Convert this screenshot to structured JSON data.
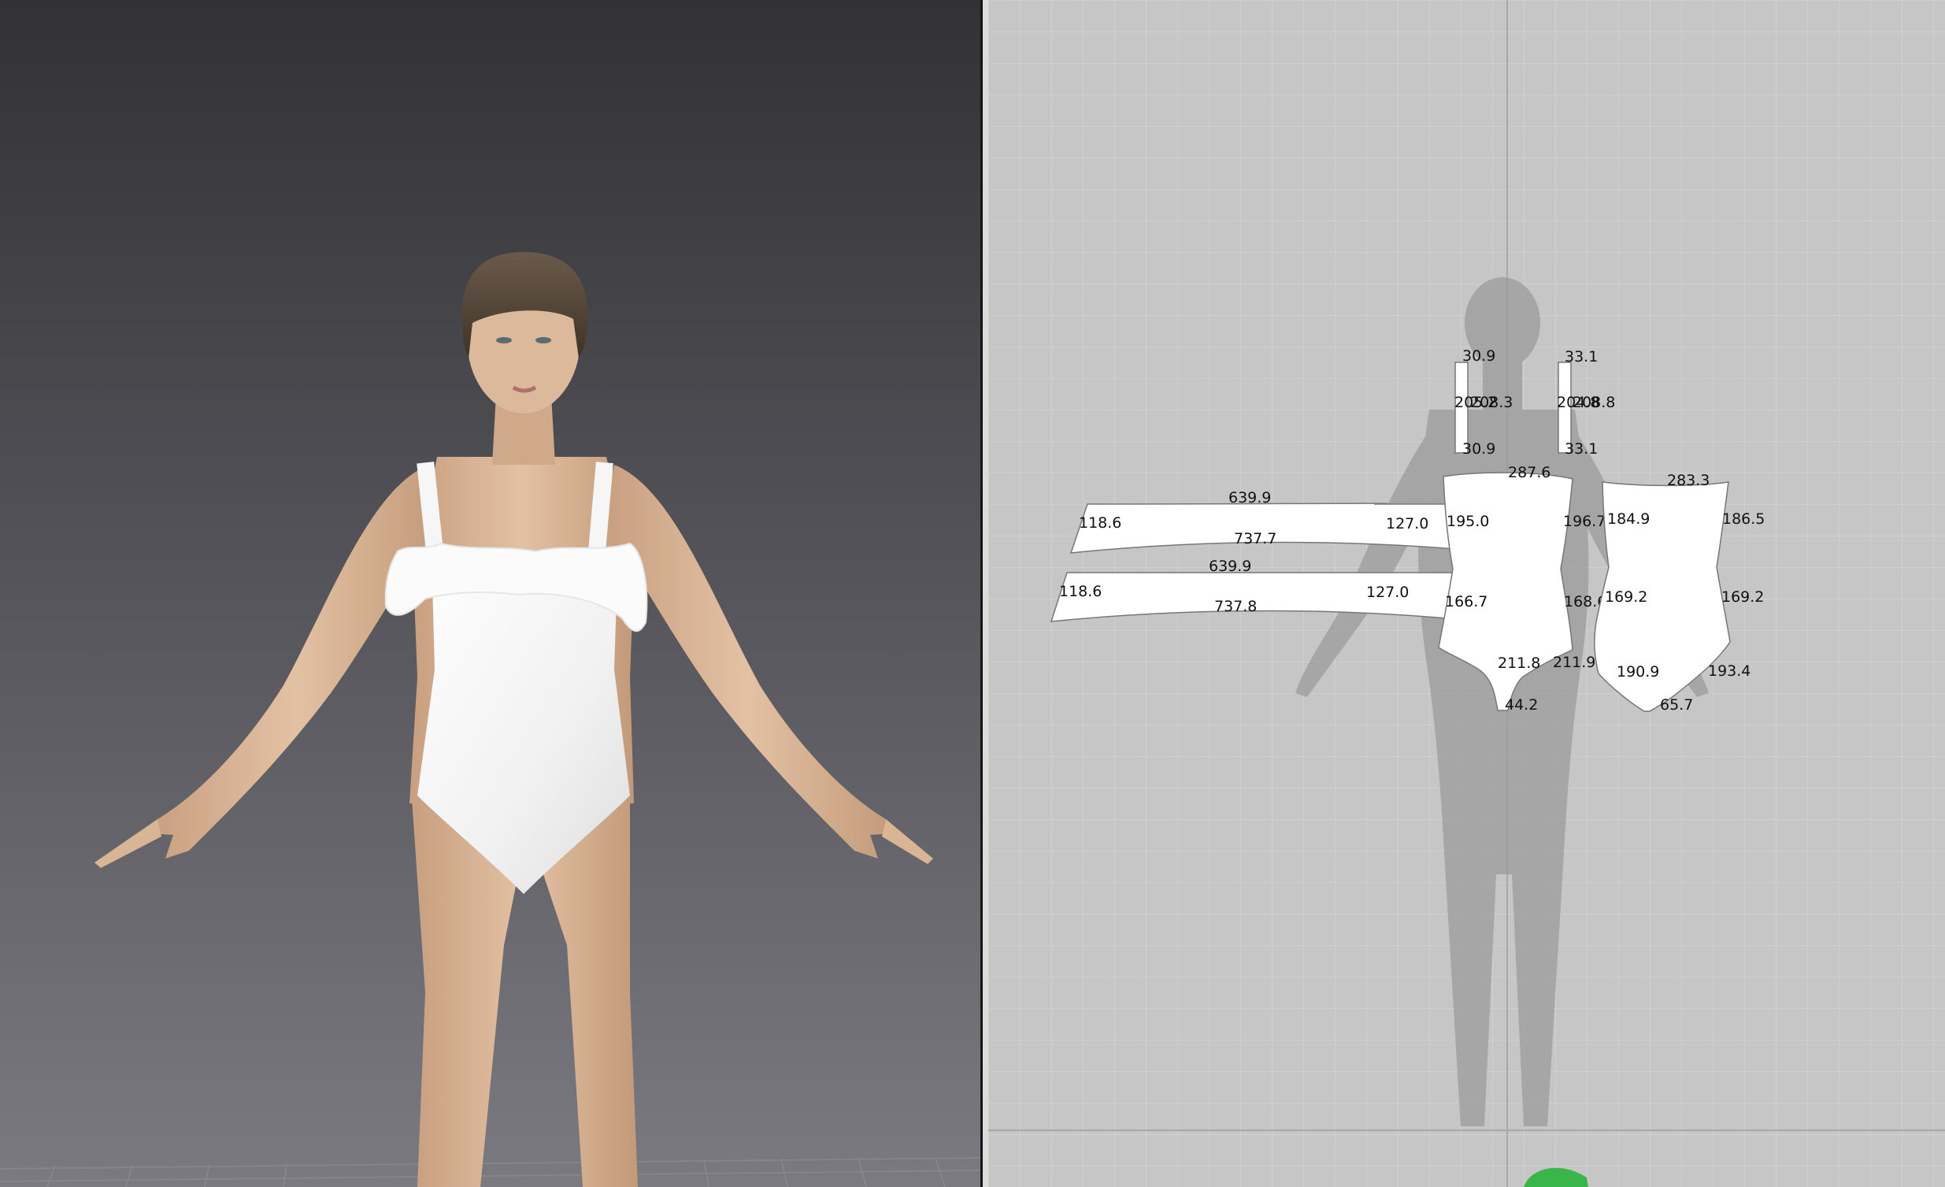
{
  "viewport_3d": {
    "avatar": "avatar-female",
    "garment": "white one-piece swimsuit with ruffle neckline and shoulder straps"
  },
  "pattern_window": {
    "pieces": [
      {
        "name": "ruffle-1",
        "labels": [
          "639.9",
          "118.6",
          "127.0",
          "737.7"
        ]
      },
      {
        "name": "ruffle-2",
        "labels": [
          "639.9",
          "118.6",
          "127.0",
          "737.8"
        ]
      },
      {
        "name": "strap-left",
        "labels": [
          "30.9",
          "208.3",
          "205.2",
          "30.9"
        ]
      },
      {
        "name": "strap-right",
        "labels": [
          "33.1",
          "208.8",
          "204.8",
          "33.1"
        ]
      },
      {
        "name": "front-body",
        "labels": [
          "287.6",
          "195.0",
          "196.7",
          "166.7",
          "168.6",
          "211.8",
          "211.9",
          "44.2"
        ]
      },
      {
        "name": "back-body",
        "labels": [
          "283.3",
          "184.9",
          "186.5",
          "169.2",
          "169.2",
          "190.9",
          "193.4",
          "65.7"
        ]
      }
    ]
  },
  "colors": {
    "pattern_bg": "#c6c6c6",
    "piece_fill": "#ffffff",
    "avatar_silhouette": "#9b9b9b",
    "center_guide": "#a8a8a8",
    "green_handle": "#39b54a"
  }
}
